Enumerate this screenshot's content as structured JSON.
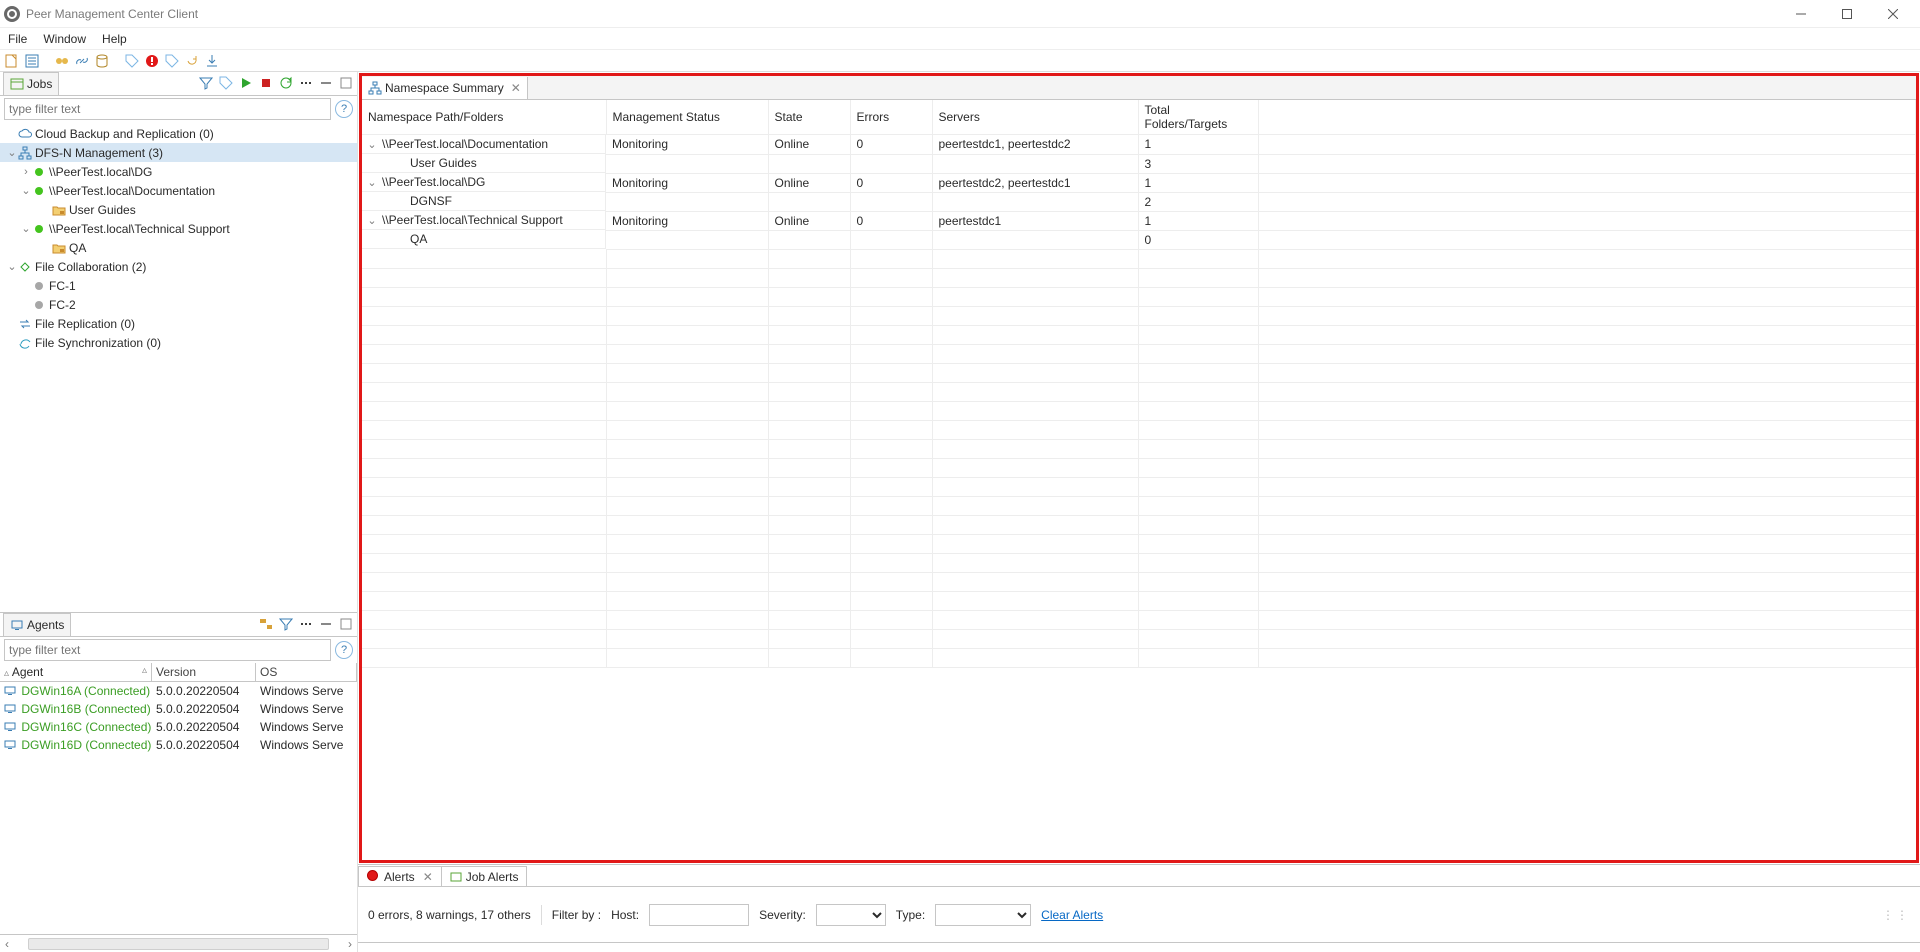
{
  "window": {
    "title": "Peer Management Center Client"
  },
  "menu": {
    "file": "File",
    "window": "Window",
    "help": "Help"
  },
  "jobs": {
    "title": "Jobs",
    "filter_placeholder": "type filter text",
    "tree": [
      {
        "id": "cloud",
        "depth": 1,
        "twist": "",
        "ico": "cloud",
        "label": "Cloud Backup and Replication (0)"
      },
      {
        "id": "dfs",
        "depth": 1,
        "twist": "v",
        "ico": "dfs",
        "label": "DFS-N Management (3)",
        "selected": true
      },
      {
        "id": "dfs-dg",
        "depth": 2,
        "twist": ">",
        "bullet": "green",
        "label": "\\\\PeerTest.local\\DG"
      },
      {
        "id": "dfs-doc",
        "depth": 2,
        "twist": "v",
        "bullet": "green",
        "label": "\\\\PeerTest.local\\Documentation"
      },
      {
        "id": "dfs-ug",
        "depth": 3,
        "twist": "",
        "ico": "folder-lock",
        "label": "User Guides"
      },
      {
        "id": "dfs-ts",
        "depth": 2,
        "twist": "v",
        "bullet": "green",
        "label": "\\\\PeerTest.local\\Technical Support"
      },
      {
        "id": "dfs-qa",
        "depth": 3,
        "twist": "",
        "ico": "folder-lock",
        "label": "QA"
      },
      {
        "id": "fcoll",
        "depth": 1,
        "twist": "v",
        "ico": "filecol",
        "label": "File Collaboration (2)"
      },
      {
        "id": "fc1",
        "depth": 2,
        "twist": "",
        "bullet": "grey",
        "label": "FC-1"
      },
      {
        "id": "fc2",
        "depth": 2,
        "twist": "",
        "bullet": "grey",
        "label": "FC-2"
      },
      {
        "id": "frepl",
        "depth": 1,
        "twist": "",
        "ico": "filerepl",
        "label": "File Replication (0)"
      },
      {
        "id": "fsync",
        "depth": 1,
        "twist": "",
        "ico": "filesync",
        "label": "File Synchronization (0)"
      }
    ]
  },
  "agents": {
    "title": "Agents",
    "filter_placeholder": "type filter text",
    "cols": {
      "agent": "Agent",
      "version": "Version",
      "os": "OS"
    },
    "rows": [
      {
        "name": "DGWin16A (Connected)",
        "version": "5.0.0.20220504",
        "os": "Windows Serve"
      },
      {
        "name": "DGWin16B (Connected)",
        "version": "5.0.0.20220504",
        "os": "Windows Serve"
      },
      {
        "name": "DGWin16C (Connected)",
        "version": "5.0.0.20220504",
        "os": "Windows Serve"
      },
      {
        "name": "DGWin16D (Connected)",
        "version": "5.0.0.20220504",
        "os": "Windows Serve"
      }
    ]
  },
  "ns": {
    "title": "Namespace Summary",
    "cols": {
      "path": "Namespace Path/Folders",
      "status": "Management Status",
      "state": "State",
      "errors": "Errors",
      "servers": "Servers",
      "total": "Total Folders/Targets"
    },
    "rows": [
      {
        "twist": "v",
        "indent": 0,
        "path": "\\\\PeerTest.local\\Documentation",
        "status": "Monitoring",
        "state": "Online",
        "errors": "0",
        "servers": "peertestdc1, peertestdc2",
        "total": "1"
      },
      {
        "twist": "",
        "indent": 1,
        "path": "User Guides",
        "status": "",
        "state": "",
        "errors": "",
        "servers": "",
        "total": "3"
      },
      {
        "twist": "v",
        "indent": 0,
        "path": "\\\\PeerTest.local\\DG",
        "status": "Monitoring",
        "state": "Online",
        "errors": "0",
        "servers": "peertestdc2, peertestdc1",
        "total": "1"
      },
      {
        "twist": "",
        "indent": 1,
        "path": "DGNSF",
        "status": "",
        "state": "",
        "errors": "",
        "servers": "",
        "total": "2"
      },
      {
        "twist": "v",
        "indent": 0,
        "path": "\\\\PeerTest.local\\Technical Support",
        "status": "Monitoring",
        "state": "Online",
        "errors": "0",
        "servers": "peertestdc1",
        "total": "1"
      },
      {
        "twist": "",
        "indent": 1,
        "path": "QA",
        "status": "",
        "state": "",
        "errors": "",
        "servers": "",
        "total": "0"
      }
    ],
    "blank_rows": 22
  },
  "alerts": {
    "tab1": "Alerts",
    "tab2": "Job Alerts",
    "summary": "0 errors, 8 warnings, 17 others",
    "filter_by": "Filter by :",
    "host": "Host:",
    "severity": "Severity:",
    "type": "Type:",
    "clear": "Clear Alerts"
  }
}
